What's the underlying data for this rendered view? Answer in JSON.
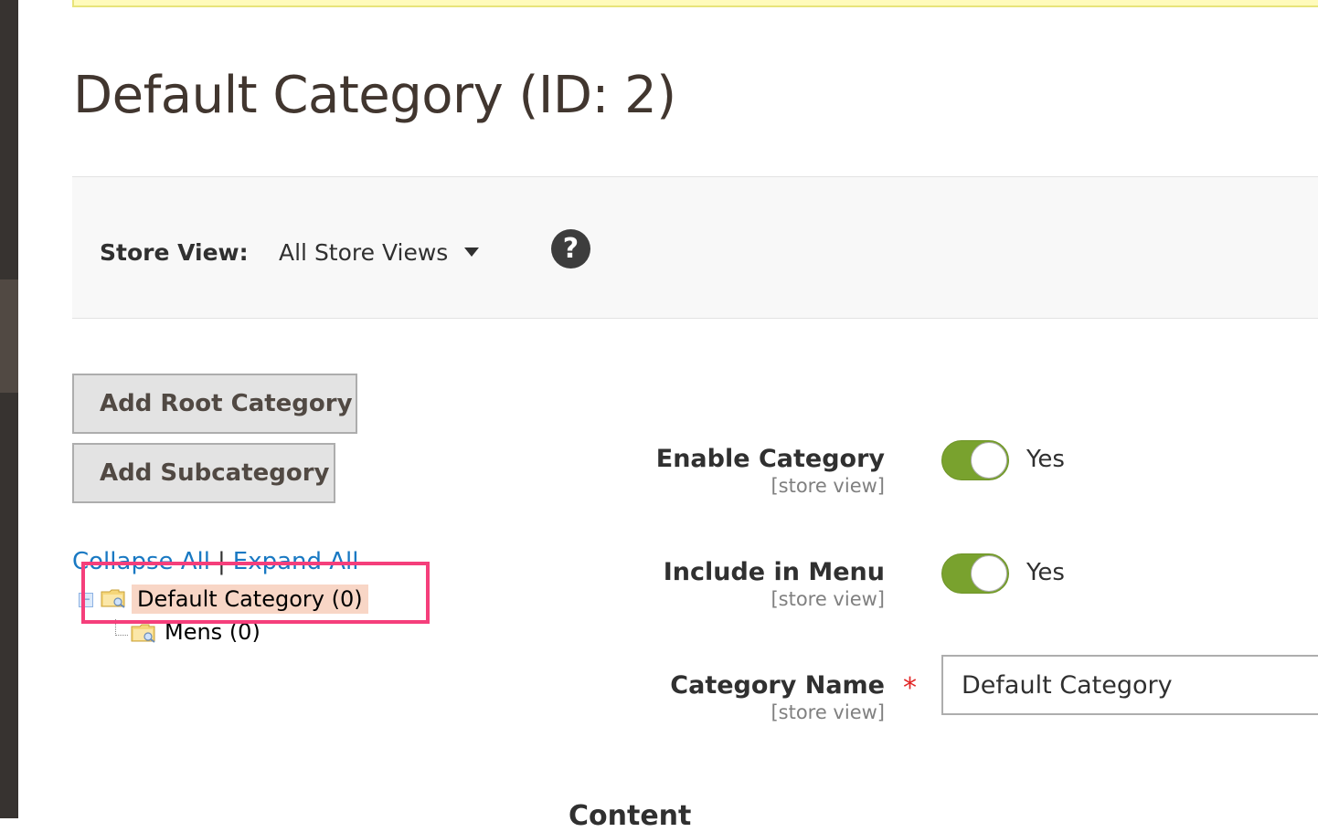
{
  "page": {
    "title": "Default Category (ID: 2)"
  },
  "store_switcher": {
    "label": "Store View:",
    "selected": "All Store Views",
    "help_icon": "question-circle-icon"
  },
  "buttons": {
    "add_root": "Add Root Category",
    "add_subcategory": "Add Subcategory"
  },
  "tree": {
    "collapse_all": "Collapse All",
    "separator": "|",
    "expand_all": "Expand All",
    "root": {
      "label": "Default Category (0)",
      "icon": "folder-icon",
      "selected": true
    },
    "children": [
      {
        "label": "Mens (0)",
        "icon": "folder-icon"
      }
    ]
  },
  "form": {
    "enable_category": {
      "label": "Enable Category",
      "scope": "[store view]",
      "value": "Yes",
      "on": true
    },
    "include_in_menu": {
      "label": "Include in Menu",
      "scope": "[store view]",
      "value": "Yes",
      "on": true
    },
    "category_name": {
      "label": "Category Name",
      "scope": "[store view]",
      "required_mark": "*",
      "value": "Default Category"
    }
  },
  "section": {
    "title": "Content"
  },
  "colors": {
    "accent_switch": "#79a22e",
    "link": "#1979c3",
    "highlight_border": "#f53f7b",
    "selected_node_bg": "#f8d6c6",
    "required": "#e22626"
  }
}
